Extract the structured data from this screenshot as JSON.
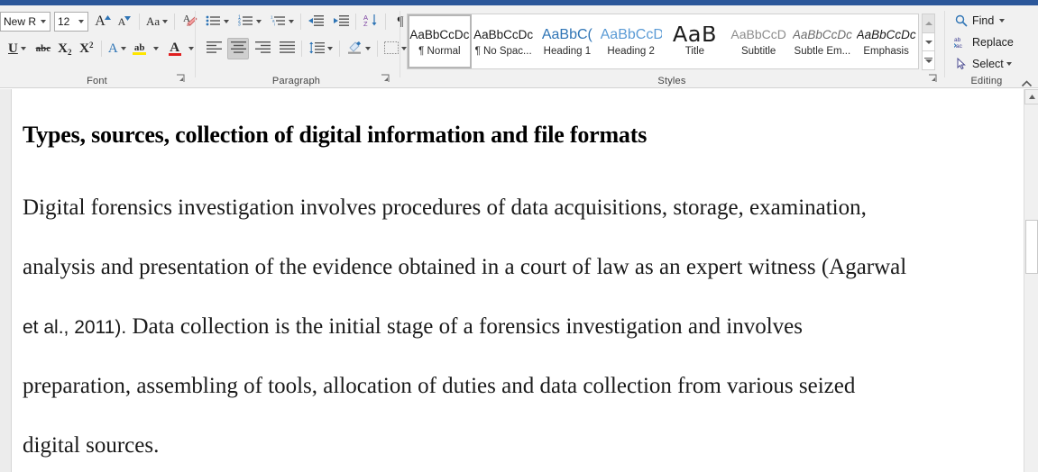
{
  "window": {
    "accent_color": "#2b579a",
    "ribbon_bg": "#f1f1f1"
  },
  "ribbon": {
    "font_group": {
      "label": "Font",
      "font_name_value": "New Ro",
      "font_size_value": "12",
      "grow_font": "A",
      "shrink_font": "A",
      "change_case": "Aa",
      "clear_formatting": "clear-formatting",
      "underline": "U",
      "strikethrough": "abc",
      "subscript_base": "X",
      "subscript_mark": "2",
      "superscript_base": "X",
      "superscript_mark": "2",
      "text_effects": "A",
      "highlight": "ab",
      "highlight_color": "#ffe600",
      "font_color": "A",
      "font_color_value": "#e02020",
      "dialog_launcher": "Font dialog launcher"
    },
    "paragraph_group": {
      "label": "Paragraph",
      "bullets": "bullets",
      "numbering": "numbering",
      "multilevel": "multilevel-list",
      "decrease_indent": "decrease-indent",
      "increase_indent": "increase-indent",
      "sort": "sort",
      "show_marks": "¶",
      "align_left": "align-left",
      "align_center": "align-center",
      "align_right": "align-right",
      "justify": "justify",
      "line_spacing": "line-spacing",
      "shading": "shading",
      "borders": "borders",
      "active_alignment": "align_center",
      "dialog_launcher": "Paragraph dialog launcher"
    },
    "styles_group": {
      "label": "Styles",
      "dialog_launcher": "Styles dialog launcher",
      "items": [
        {
          "preview": "AaBbCcDc",
          "name": "¶ Normal",
          "selected": true,
          "style_class": "sp-normal"
        },
        {
          "preview": "AaBbCcDc",
          "name": "¶ No Spac...",
          "selected": false,
          "style_class": "sp-nospace"
        },
        {
          "preview": "AaBbC(",
          "name": "Heading 1",
          "selected": false,
          "style_class": "sp-h1"
        },
        {
          "preview": "AaBbCcD",
          "name": "Heading 2",
          "selected": false,
          "style_class": "sp-h2"
        },
        {
          "preview": "AaB",
          "name": "Title",
          "selected": false,
          "style_class": "sp-title"
        },
        {
          "preview": "AaBbCcD",
          "name": "Subtitle",
          "selected": false,
          "style_class": "sp-subtitle"
        },
        {
          "preview": "AaBbCcDc",
          "name": "Subtle Em...",
          "selected": false,
          "style_class": "sp-subtleem"
        },
        {
          "preview": "AaBbCcDc",
          "name": "Emphasis",
          "selected": false,
          "style_class": "sp-emphasis"
        }
      ],
      "scroll_up": "scroll-up",
      "scroll_down": "scroll-down",
      "more": "more-styles"
    },
    "editing_group": {
      "label": "Editing",
      "find": "Find",
      "replace": "Replace",
      "select": "Select",
      "replace_icon_top": "ab",
      "replace_icon_bottom": "ac"
    },
    "collapse_ribbon": "collapse-ribbon"
  },
  "document": {
    "heading": "Types, sources, collection of digital information and file formats",
    "lines": [
      {
        "text": "Digital forensics investigation involves procedures of data acquisitions, storage, examination,",
        "font": "serif"
      },
      {
        "text": "analysis and presentation of the evidence obtained in a court of law as an expert witness (Agarwal",
        "font": "serif"
      },
      {
        "text": "et al., 2011). Data collection is the initial stage of a forensics investigation and involves",
        "font": "mixed",
        "sans_part": "et al., 2011).",
        "serif_part": " Data collection is the initial stage of a forensics investigation and involves"
      },
      {
        "text": "preparation, assembling of tools, allocation of duties and data collection from various seized",
        "font": "serif"
      },
      {
        "text": "digital sources.",
        "font": "serif"
      }
    ]
  },
  "scrollbar": {
    "up_arrow": "scroll-up-arrow",
    "thumb": "scroll-thumb"
  }
}
